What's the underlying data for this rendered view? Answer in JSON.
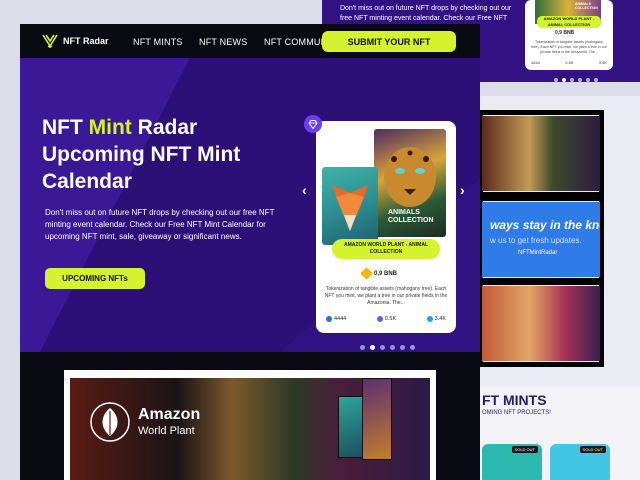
{
  "background_page": {
    "hero_text": "Don't miss out on future NFT drops by checking out our free NFT minting event calendar. Check our Free NFT",
    "mini_card": {
      "title": "AMAZON WORLD PLANT - ANIMAL COLLECTION",
      "back_label": "ANIMALS COLLECTION",
      "price": "0,9 BNB",
      "description": "Tokenization of tangible assets (mahogany tree). Each NFT you mint, we plant a tree in our private fields in the Amazonia. The...",
      "stats": [
        "4444",
        "0.5K",
        "3.4K"
      ]
    },
    "stay_title": "ways stay in the know!",
    "stay_sub": "w us to get fresh updates.",
    "stay_handle": "NFTMintRadar",
    "mints_title": "FT MINTS",
    "mints_sub": "OMING NFT PROJECTS!",
    "sold_out_label": "SOLD OUT"
  },
  "nav": {
    "logo_text": "NFT Radar",
    "links": [
      "NFT MINTS",
      "NFT NEWS",
      "NFT COMMUNITY"
    ],
    "submit_label": "SUBMIT YOUR NFT"
  },
  "hero": {
    "title_line1_pre": "NFT ",
    "title_line1_highlight": "Mint",
    "title_line1_post": " Radar",
    "title_line2": "Upcoming NFT Mint",
    "title_line3": "Calendar",
    "description": "Don't miss out on future NFT drops by checking out our free NFT minting event calendar. Check our Free NFT Mint Calendar for upcoming NFT mint, sale, giveaway or significant news.",
    "cta_label": "UPCOMING NFTs",
    "prev_arrow": "‹",
    "next_arrow": "›",
    "slides_total": 6,
    "slide_active": 2
  },
  "featured_card": {
    "title": "AMAZON WORLD PLANT - ANIMAL COLLECTION",
    "back_label": "ANIMALS COLLECTION",
    "price": "0,9 BNB",
    "description": "Tokenization of tangible assets (mahogany tree). Each NFT you mint, we plant a tree in our private fields in the Amazonia. The...",
    "stats": {
      "supply": "4444",
      "discord": "0.5K",
      "twitter": "3.4K"
    }
  },
  "feature_banner": {
    "name_line1": "Amazon",
    "name_line2": "World Plant"
  },
  "colors": {
    "accent": "#d4f22e",
    "hero_bg": "#311282",
    "dark_bg": "#0a0a12"
  }
}
